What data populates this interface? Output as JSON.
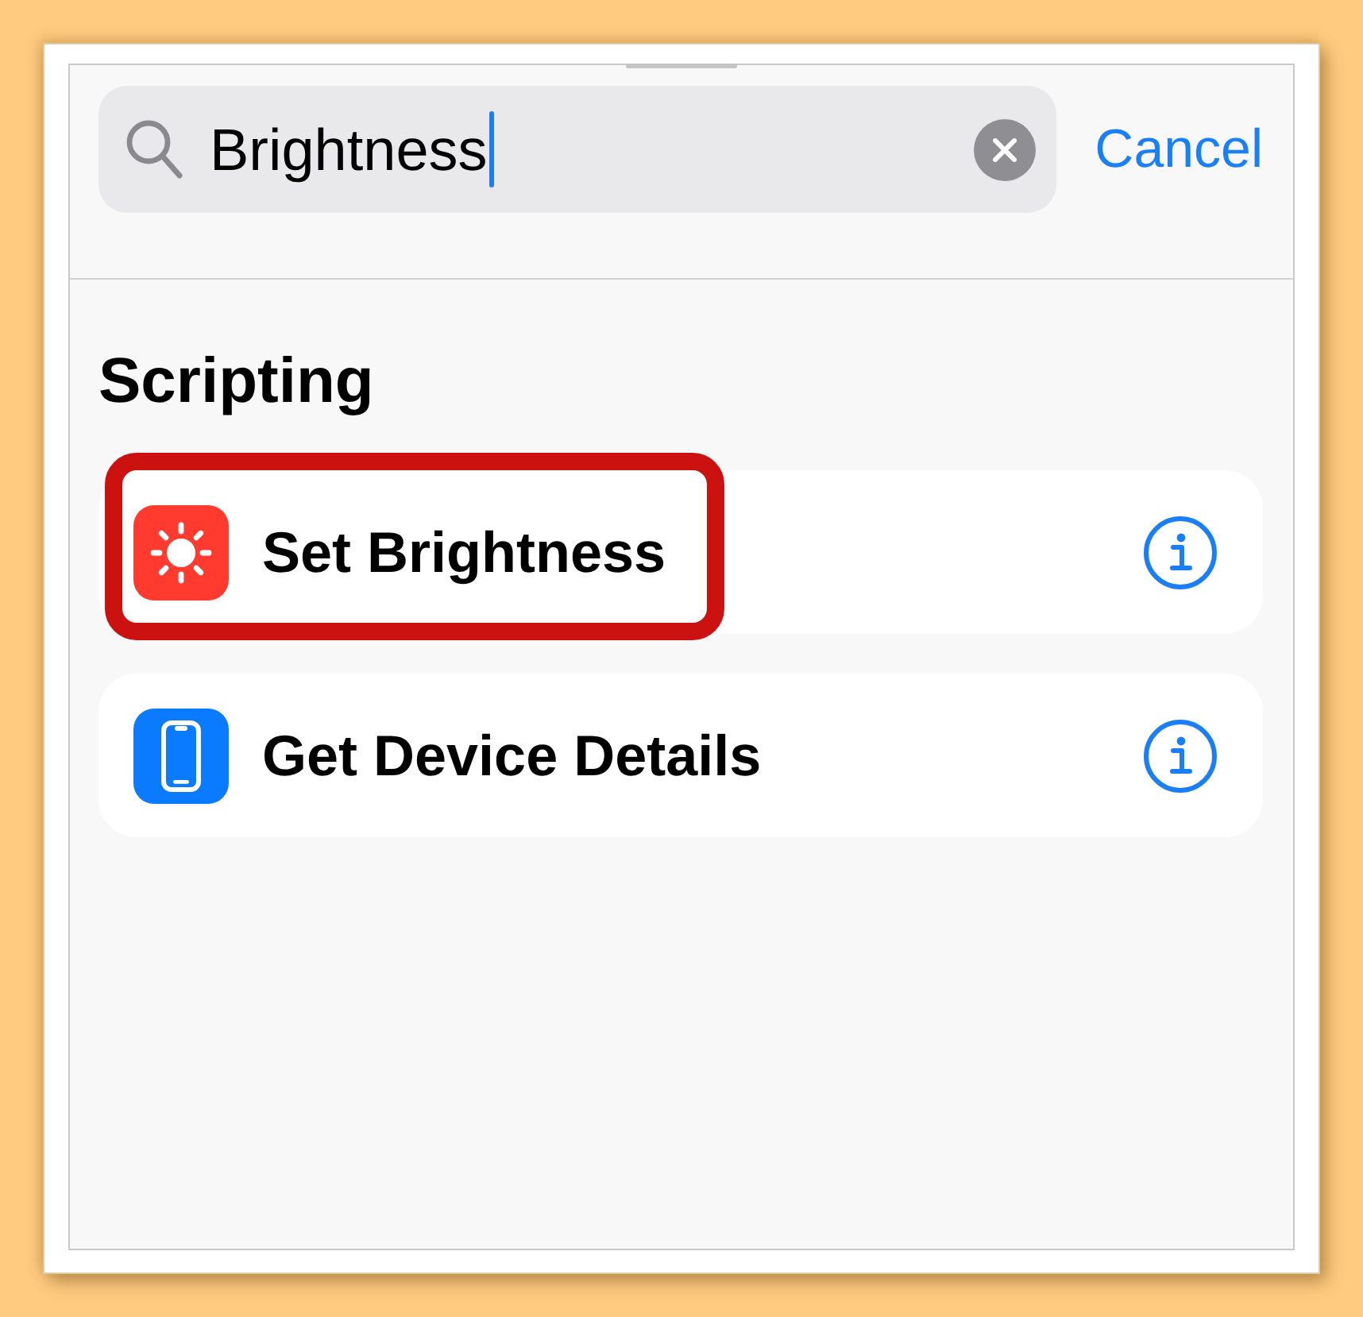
{
  "search": {
    "value": "Brightness",
    "focused": true
  },
  "cancel_label": "Cancel",
  "sections": [
    {
      "title": "Scripting",
      "actions": [
        {
          "label": "Set Brightness",
          "kind": "brightness",
          "color": "#ff3b30",
          "highlighted": true
        },
        {
          "label": "Get Device Details",
          "kind": "device",
          "color": "#0a7aff",
          "highlighted": false
        }
      ]
    }
  ]
}
